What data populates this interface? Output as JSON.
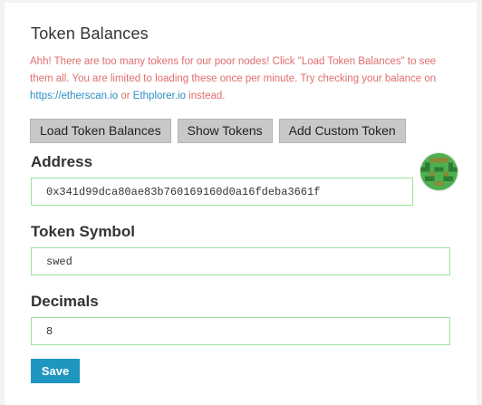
{
  "section": {
    "title": "Token Balances",
    "warning_text": "Ahh! There are too many tokens for our poor nodes! Click \"Load Token Balances\" to see them all. You are limited to loading these once per minute. Try checking your balance on ",
    "link1": "https://etherscan.io",
    "or_text": " or ",
    "link2": "Ethplorer.io",
    "instead_text": " instead."
  },
  "buttons": {
    "load": "Load Token Balances",
    "show": "Show Tokens",
    "add": "Add Custom Token"
  },
  "form": {
    "address_label": "Address",
    "address_value": "0x341d99dca80ae83b760169160d0a16fdeba3661f",
    "symbol_label": "Token Symbol",
    "symbol_value": "swed",
    "decimals_label": "Decimals",
    "decimals_value": "8",
    "save_label": "Save"
  },
  "colors": {
    "warning": "#e06d6d",
    "link": "#2d8fc4",
    "field_border": "#9be39b",
    "save_bg": "#1e96c0",
    "identicon_green": "#4caf50",
    "identicon_dark": "#2e7d32",
    "identicon_olive": "#8a8a3a"
  }
}
